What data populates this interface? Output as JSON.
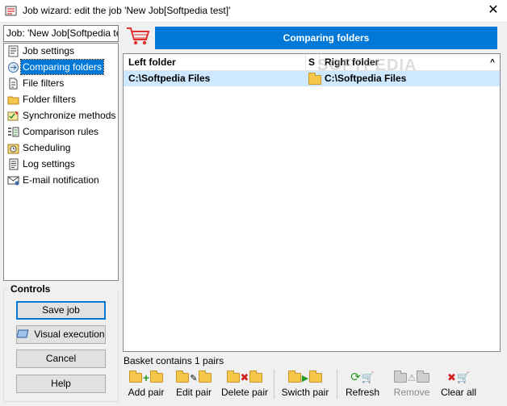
{
  "window": {
    "title": "Job wizard: edit the job 'New Job[Softpedia test]'",
    "close_glyph": "✕"
  },
  "job_field": {
    "value": "Job: 'New Job[Softpedia tes"
  },
  "banner": {
    "title": "Comparing folders"
  },
  "nav": {
    "items": [
      {
        "label": "Job settings",
        "icon": "job-settings-icon"
      },
      {
        "label": "Comparing folders",
        "icon": "compare-folders-icon",
        "selected": true
      },
      {
        "label": "File filters",
        "icon": "file-filter-icon"
      },
      {
        "label": "Folder filters",
        "icon": "folder-filter-icon"
      },
      {
        "label": "Synchronize methods",
        "icon": "sync-methods-icon"
      },
      {
        "label": "Comparison rules",
        "icon": "comparison-rules-icon"
      },
      {
        "label": "Scheduling",
        "icon": "scheduling-icon"
      },
      {
        "label": "Log settings",
        "icon": "log-settings-icon"
      },
      {
        "label": "E-mail notification",
        "icon": "email-icon"
      }
    ]
  },
  "controls": {
    "title": "Controls",
    "save_label": "Save job",
    "visual_label": "Visual execution",
    "cancel_label": "Cancel",
    "help_label": "Help"
  },
  "list": {
    "columns": [
      "Left folder",
      "S",
      "Right folder"
    ],
    "rows": [
      {
        "left": "C:\\Softpedia Files",
        "right": "C:\\Softpedia Files"
      }
    ],
    "watermark": "SOFTPEDIA"
  },
  "status": {
    "basket": "Basket contains 1 pairs"
  },
  "toolbar": {
    "add_pair": "Add pair",
    "edit_pair": "Edit pair",
    "delete_pair": "Delete pair",
    "switch_pair": "Swicth pair",
    "refresh": "Refresh",
    "remove": "Remove",
    "clear_all": "Clear all"
  },
  "colors": {
    "accent": "#0078d7",
    "selection_row": "#cde8ff",
    "folder": "#f5c84c"
  }
}
